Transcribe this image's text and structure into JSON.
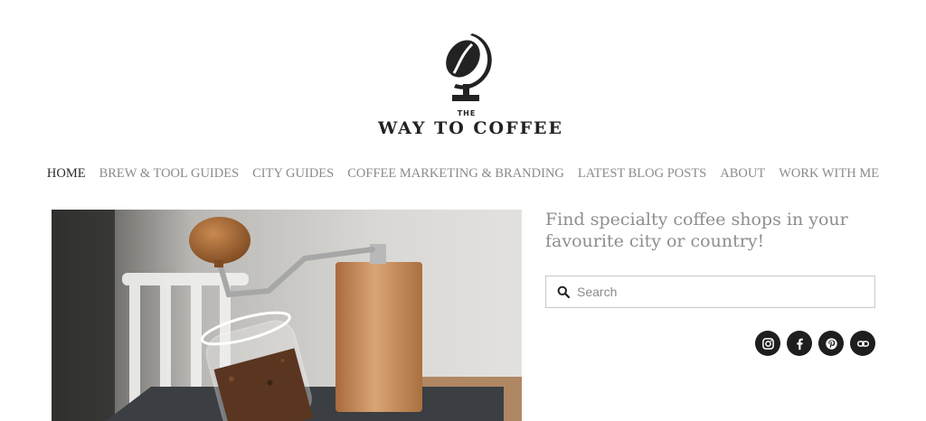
{
  "brand": {
    "logo_small": "THE",
    "logo_name": "WAY TO COFFEE"
  },
  "nav": {
    "items": [
      {
        "label": "HOME",
        "active": true
      },
      {
        "label": "BREW & TOOL GUIDES",
        "active": false
      },
      {
        "label": "CITY GUIDES",
        "active": false
      },
      {
        "label": "COFFEE MARKETING & BRANDING",
        "active": false
      },
      {
        "label": "LATEST BLOG POSTS",
        "active": false
      },
      {
        "label": "ABOUT",
        "active": false
      },
      {
        "label": "WORK WITH ME",
        "active": false
      }
    ]
  },
  "sidebar": {
    "tagline": "Find specialty coffee shops in your favourite city or country!",
    "search": {
      "placeholder": "Search",
      "value": ""
    },
    "social": [
      {
        "icon": "instagram-icon"
      },
      {
        "icon": "facebook-icon"
      },
      {
        "icon": "pinterest-icon"
      },
      {
        "icon": "link-icon"
      }
    ]
  },
  "hero": {
    "image": "coffee-grinder-photo"
  },
  "colors": {
    "nav_active": "#2b2b2b",
    "nav_inactive": "#8a8a8a",
    "tagline": "#8e8e8e",
    "icon_bg": "#1e1e1e"
  }
}
